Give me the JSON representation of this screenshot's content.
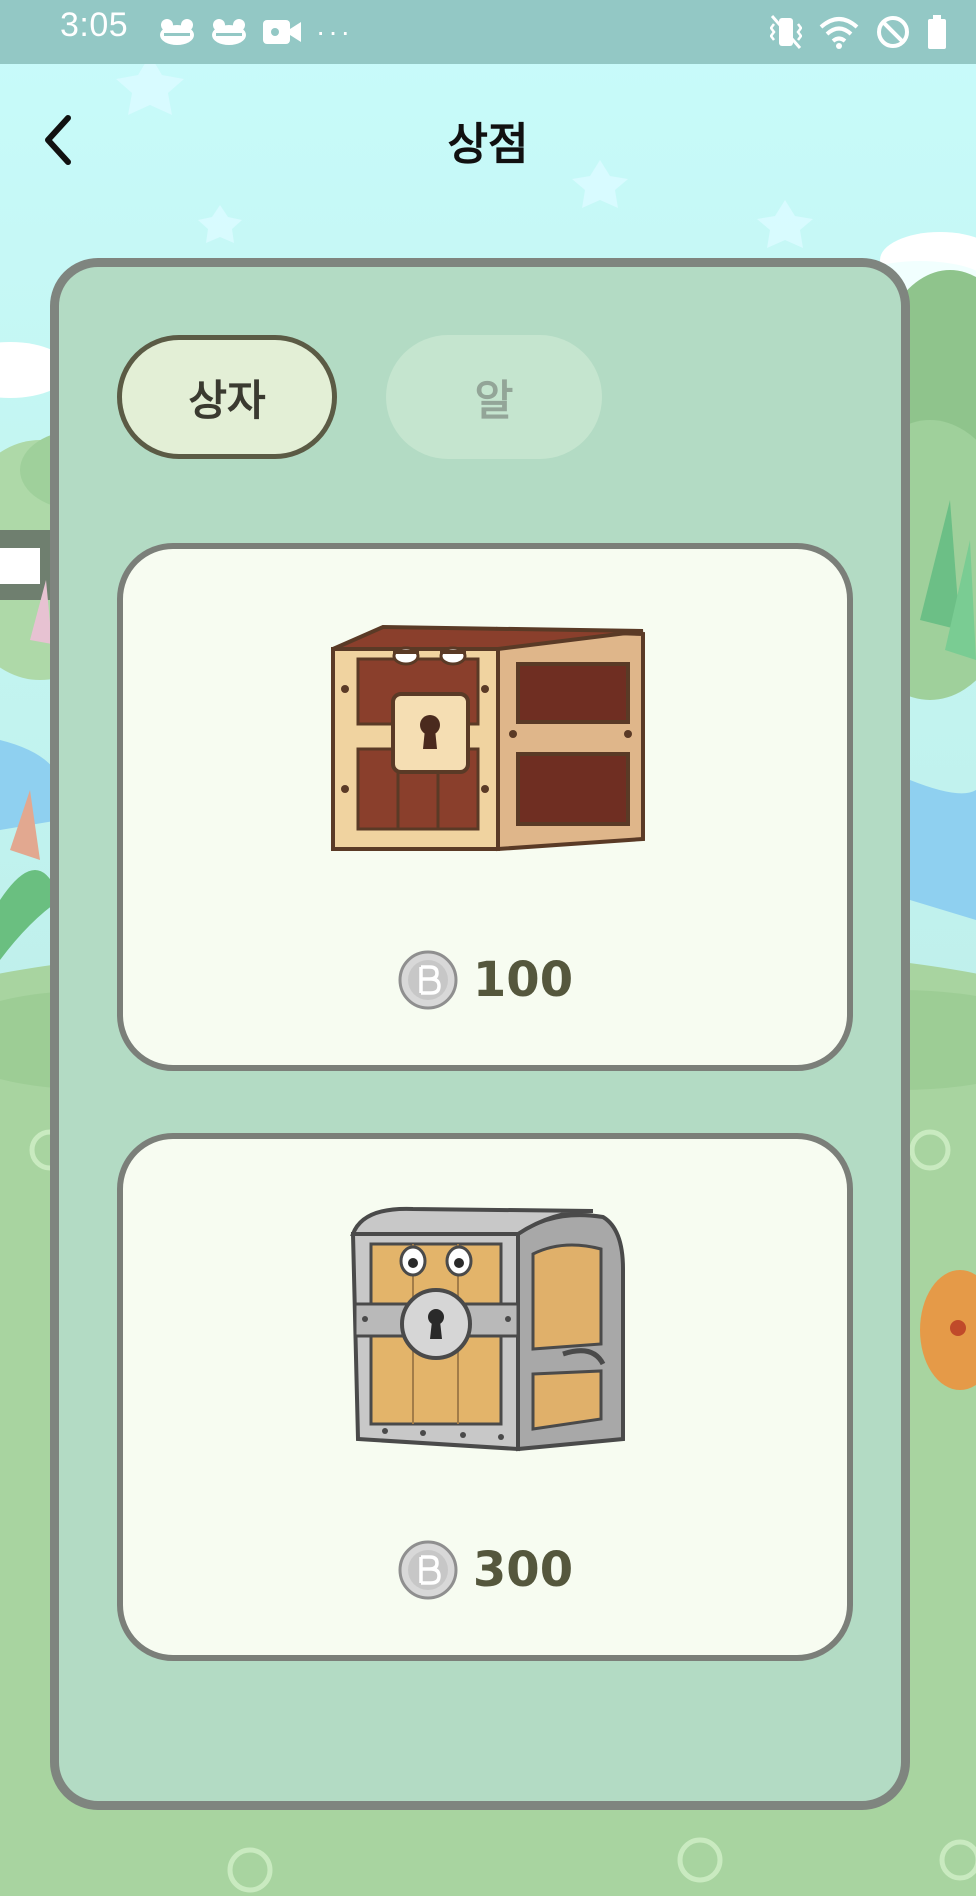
{
  "status_bar": {
    "time": "3:05",
    "left_icons": [
      "frog-notification-icon",
      "frog-notification-icon",
      "video-icon"
    ],
    "overflow": "···",
    "right_icons": [
      "vibrate-icon",
      "wifi-icon",
      "do-not-disturb-icon",
      "battery-icon"
    ]
  },
  "header": {
    "title": "상점",
    "back_icon": "chevron-left-icon"
  },
  "tabs": [
    {
      "label": "상자",
      "selected": true
    },
    {
      "label": "알",
      "selected": false
    }
  ],
  "items": [
    {
      "name_icon": "wooden-chest-icon",
      "price": "100",
      "currency_icon": "coin-icon"
    },
    {
      "name_icon": "iron-chest-icon",
      "price": "300",
      "currency_icon": "coin-icon"
    }
  ],
  "colors": {
    "status_bar": "#93c8c5",
    "panel": "#b3dbc4",
    "panel_border": "#7f857f",
    "card": "#f7fcf1",
    "price_text": "#55573d",
    "selected_tab": "#e3efd6"
  }
}
